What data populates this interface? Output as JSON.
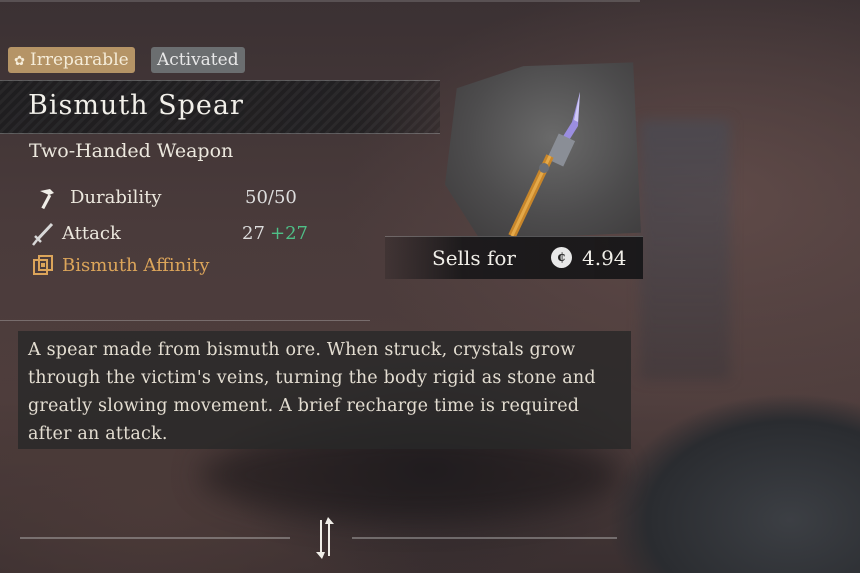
{
  "badges": {
    "irreparable": "Irreparable",
    "activated": "Activated"
  },
  "item": {
    "name": "Bismuth Spear",
    "type": "Two-Handed Weapon",
    "stats": {
      "durability_label": "Durability",
      "durability_value": "50/50",
      "attack_label": "Attack",
      "attack_value": "27",
      "attack_bonus": "+27",
      "affinity_label": "Bismuth Affinity"
    },
    "sell_label": "Sells for",
    "sell_value": "4.94",
    "description": "A spear made from bismuth ore. When struck, crystals grow through the victim's veins, turning the body rigid as stone and greatly slowing movement. A brief recharge time is required after an attack."
  },
  "icons": {
    "irreparable": "gear-icon",
    "durability": "hammer-icon",
    "attack": "sword-icon",
    "affinity": "affinity-icon",
    "currency": "coin-icon",
    "swap": "swap-icon"
  },
  "colors": {
    "irreparable_badge": "#b59466",
    "activated_badge": "#6b6e70",
    "attack_bonus": "#4fc088",
    "affinity": "#dca55a",
    "spear_crystal": "#9b8ee0",
    "spear_shaft": "#c8862a"
  }
}
